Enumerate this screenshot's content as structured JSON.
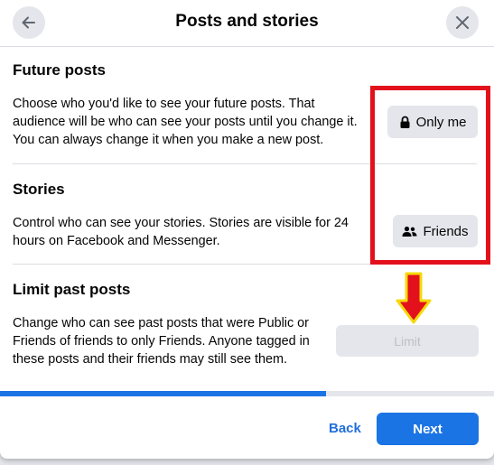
{
  "dialog": {
    "title": "Posts and stories",
    "back_icon": "arrow-left-icon",
    "close_icon": "close-icon"
  },
  "sections": {
    "future_posts": {
      "title": "Future posts",
      "description_lines": [
        "Choose who you'd like to see your future posts. That",
        "audience will be who can see your posts until you change it.",
        "You can always change it when you make a new post."
      ],
      "button_label": "Only me",
      "button_icon": "lock-icon"
    },
    "stories": {
      "title": "Stories",
      "description_lines": [
        "Control who can see your stories. Stories are visible for 24",
        "hours on Facebook and Messenger."
      ],
      "button_label": "Friends",
      "button_icon": "friends-icon"
    },
    "limit_past_posts": {
      "title": "Limit past posts",
      "description_lines": [
        "Change who can see past posts that were Public or",
        "Friends of friends to only Friends. Anyone tagged in",
        "these posts and their friends may still see them."
      ],
      "button_label": "Limit",
      "button_state": "disabled"
    }
  },
  "progress": {
    "fraction": 0.66
  },
  "footer": {
    "back_label": "Back",
    "next_label": "Next"
  },
  "annotations": {
    "highlight_box_color": "#e3111b",
    "arrow_fill_color": "#e3111b",
    "arrow_outline_color": "#f5d90a"
  },
  "colors": {
    "accent": "#1b74e4",
    "link": "#216fdb",
    "button_bg": "#e4e6eb"
  }
}
